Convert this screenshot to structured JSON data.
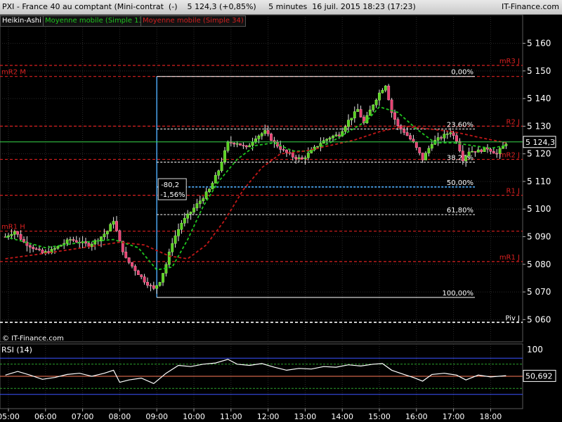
{
  "window": {
    "title": "PXI - France 40 au comptant (Mini-contrat  (-)    5 124,3 (+0,85%)     5 minutes  16 juil. 2015 18:23 (17:23)",
    "source_link": "IT-Finance.com"
  },
  "indicators": {
    "type_label": "Heikin-Ashi",
    "ma13_label": "Moyenne mobile (Simple 13)",
    "ma34_label": "Moyenne mobile (Simple 34)"
  },
  "colors": {
    "bull": "#58d11f",
    "bear": "#e64070",
    "ma13": "#1fc41f",
    "ma34": "#c01818",
    "pivot_red": "#d82020",
    "fib": "#ffffff",
    "fib_mid": "#4fb0ff",
    "rsi": "#ffffff",
    "rsi_band_top": "#3a52ff",
    "rsi_band_mid": "#2ca02c",
    "rsi_band_bot": "#ff7b5a"
  },
  "chart_data": [
    {
      "type": "candlestick",
      "title": "",
      "ylim": [
        5055,
        5166
      ],
      "y_ticks": [
        5060,
        5070,
        5080,
        5090,
        5100,
        5110,
        5120,
        5130,
        5140,
        5150,
        5160
      ],
      "y_tick_labels": [
        "5 060",
        "5 070",
        "5 080",
        "5 090",
        "5 100",
        "5 110",
        "5 120",
        "5 130",
        "5 140",
        "5 150",
        "5 160"
      ],
      "x_ticks": [
        "05:00",
        "06:00",
        "07:00",
        "08:00",
        "09:00",
        "10:00",
        "11:00",
        "12:00",
        "13:00",
        "14:00",
        "15:00",
        "16:00",
        "17:00",
        "18:00"
      ],
      "x_start": "04:55",
      "x_end": "18:25",
      "grid": true,
      "current_value_label": "5 124,3",
      "current_value": 5124.3,
      "price_path": [
        [
          "04:55",
          5090
        ],
        [
          "05:10",
          5092
        ],
        [
          "05:25",
          5088
        ],
        [
          "05:40",
          5086
        ],
        [
          "05:55",
          5084
        ],
        [
          "06:10",
          5085
        ],
        [
          "06:25",
          5087
        ],
        [
          "06:40",
          5089
        ],
        [
          "06:55",
          5088
        ],
        [
          "07:10",
          5087
        ],
        [
          "07:25",
          5089
        ],
        [
          "07:40",
          5092
        ],
        [
          "07:50",
          5096
        ],
        [
          "08:00",
          5088
        ],
        [
          "08:10",
          5082
        ],
        [
          "08:25",
          5078
        ],
        [
          "08:40",
          5074
        ],
        [
          "08:55",
          5071
        ],
        [
          "09:05",
          5074
        ],
        [
          "09:15",
          5080
        ],
        [
          "09:25",
          5088
        ],
        [
          "09:40",
          5095
        ],
        [
          "09:55",
          5099
        ],
        [
          "10:10",
          5103
        ],
        [
          "10:25",
          5107
        ],
        [
          "10:40",
          5114
        ],
        [
          "10:55",
          5124
        ],
        [
          "11:10",
          5124
        ],
        [
          "11:25",
          5122
        ],
        [
          "11:40",
          5126
        ],
        [
          "11:55",
          5128
        ],
        [
          "12:10",
          5124
        ],
        [
          "12:25",
          5121
        ],
        [
          "12:40",
          5119
        ],
        [
          "12:55",
          5118
        ],
        [
          "13:10",
          5121
        ],
        [
          "13:25",
          5124
        ],
        [
          "13:40",
          5126
        ],
        [
          "13:55",
          5127
        ],
        [
          "14:10",
          5132
        ],
        [
          "14:25",
          5136
        ],
        [
          "14:35",
          5131
        ],
        [
          "14:50",
          5138
        ],
        [
          "15:00",
          5142
        ],
        [
          "15:10",
          5145
        ],
        [
          "15:20",
          5135
        ],
        [
          "15:30",
          5130
        ],
        [
          "15:40",
          5128
        ],
        [
          "15:55",
          5124
        ],
        [
          "16:10",
          5118
        ],
        [
          "16:25",
          5124
        ],
        [
          "16:40",
          5126
        ],
        [
          "16:55",
          5128
        ],
        [
          "17:05",
          5125
        ],
        [
          "17:15",
          5118
        ],
        [
          "17:25",
          5121
        ],
        [
          "17:40",
          5121
        ],
        [
          "17:55",
          5122
        ],
        [
          "18:10",
          5120
        ],
        [
          "18:25",
          5124
        ]
      ],
      "moving_averages": [
        {
          "name": "Moyenne mobile (Simple 13)",
          "points": [
            [
              "04:55",
              5090
            ],
            [
              "06:00",
              5086
            ],
            [
              "07:00",
              5088
            ],
            [
              "07:50",
              5089
            ],
            [
              "08:30",
              5086
            ],
            [
              "09:00",
              5078
            ],
            [
              "09:25",
              5079
            ],
            [
              "09:50",
              5089
            ],
            [
              "10:15",
              5101
            ],
            [
              "10:40",
              5110
            ],
            [
              "11:10",
              5118
            ],
            [
              "11:40",
              5123
            ],
            [
              "12:10",
              5124
            ],
            [
              "12:40",
              5121
            ],
            [
              "13:10",
              5121
            ],
            [
              "13:40",
              5124
            ],
            [
              "14:10",
              5128
            ],
            [
              "14:40",
              5132
            ],
            [
              "15:00",
              5137
            ],
            [
              "15:30",
              5135
            ],
            [
              "16:00",
              5129
            ],
            [
              "16:30",
              5124
            ],
            [
              "17:00",
              5124
            ],
            [
              "17:30",
              5123
            ],
            [
              "18:00",
              5122
            ],
            [
              "18:25",
              5123
            ]
          ]
        },
        {
          "name": "Moyenne mobile (Simple 34)",
          "points": [
            [
              "04:55",
              5082
            ],
            [
              "06:00",
              5084
            ],
            [
              "07:00",
              5086
            ],
            [
              "08:00",
              5088
            ],
            [
              "08:40",
              5087
            ],
            [
              "09:20",
              5083
            ],
            [
              "09:50",
              5082
            ],
            [
              "10:20",
              5087
            ],
            [
              "10:50",
              5096
            ],
            [
              "11:20",
              5107
            ],
            [
              "11:50",
              5115
            ],
            [
              "12:20",
              5120
            ],
            [
              "13:00",
              5121
            ],
            [
              "13:40",
              5123
            ],
            [
              "14:20",
              5125
            ],
            [
              "15:00",
              5128
            ],
            [
              "15:40",
              5130
            ],
            [
              "16:20",
              5129
            ],
            [
              "17:00",
              5128
            ],
            [
              "17:40",
              5126
            ],
            [
              "18:25",
              5124
            ]
          ]
        }
      ],
      "levels": [
        {
          "label": "mR3 J",
          "value": 5152,
          "side": "right"
        },
        {
          "label": "mR2 M",
          "value": 5148,
          "side": "left"
        },
        {
          "label": "R2 J",
          "value": 5130,
          "side": "right"
        },
        {
          "label": "mR2 J",
          "value": 5118,
          "side": "right"
        },
        {
          "label": "R1 J",
          "value": 5105,
          "side": "right"
        },
        {
          "label": "mR1 H",
          "value": 5092,
          "side": "left"
        },
        {
          "label": "mR1 J",
          "value": 5081,
          "side": "right"
        },
        {
          "label": "Piv J",
          "value": 5059,
          "side": "right"
        }
      ],
      "fibonacci": {
        "start_time": "09:00",
        "low": 5068,
        "high": 5148,
        "levels": [
          {
            "label": "0,00%",
            "value": 5148
          },
          {
            "label": "23,60%",
            "value": 5129
          },
          {
            "label": "38,20%",
            "value": 5117
          },
          {
            "label": "50,00%",
            "value": 5108
          },
          {
            "label": "61,80%",
            "value": 5098
          },
          {
            "label": "100,00%",
            "value": 5068
          }
        ]
      },
      "measure_box": {
        "change": "-80,2",
        "percent": "-1,56%"
      }
    },
    {
      "type": "line",
      "title": "RSI (14)",
      "ylim": [
        0,
        100
      ],
      "y_tick_label": "100",
      "current_value_label": "50,692",
      "current_value": 50.692,
      "bands": [
        {
          "value": 80,
          "color_key": "rsi_band_top"
        },
        {
          "value": 70,
          "color_key": "rsi_band_mid"
        },
        {
          "value": 50,
          "color_key": "rsi_band_bot"
        },
        {
          "value": 30,
          "color_key": "rsi_band_mid"
        },
        {
          "value": 20,
          "color_key": "rsi_band_top"
        }
      ],
      "points": [
        [
          "04:55",
          52
        ],
        [
          "05:15",
          58
        ],
        [
          "05:35",
          52
        ],
        [
          "05:55",
          45
        ],
        [
          "06:15",
          48
        ],
        [
          "06:35",
          53
        ],
        [
          "06:55",
          55
        ],
        [
          "07:15",
          50
        ],
        [
          "07:35",
          55
        ],
        [
          "07:50",
          60
        ],
        [
          "08:00",
          40
        ],
        [
          "08:15",
          44
        ],
        [
          "08:35",
          47
        ],
        [
          "08:55",
          38
        ],
        [
          "09:15",
          55
        ],
        [
          "09:35",
          68
        ],
        [
          "09:55",
          66
        ],
        [
          "10:15",
          70
        ],
        [
          "10:35",
          72
        ],
        [
          "10:55",
          78
        ],
        [
          "11:10",
          70
        ],
        [
          "11:30",
          68
        ],
        [
          "11:50",
          71
        ],
        [
          "12:10",
          65
        ],
        [
          "12:30",
          60
        ],
        [
          "12:50",
          63
        ],
        [
          "13:10",
          62
        ],
        [
          "13:30",
          66
        ],
        [
          "13:50",
          65
        ],
        [
          "14:10",
          69
        ],
        [
          "14:30",
          67
        ],
        [
          "14:50",
          70
        ],
        [
          "15:05",
          71
        ],
        [
          "15:20",
          60
        ],
        [
          "15:40",
          53
        ],
        [
          "15:55",
          48
        ],
        [
          "16:10",
          42
        ],
        [
          "16:25",
          53
        ],
        [
          "16:45",
          55
        ],
        [
          "17:05",
          52
        ],
        [
          "17:20",
          44
        ],
        [
          "17:40",
          52
        ],
        [
          "18:00",
          49
        ],
        [
          "18:25",
          51
        ]
      ]
    }
  ]
}
